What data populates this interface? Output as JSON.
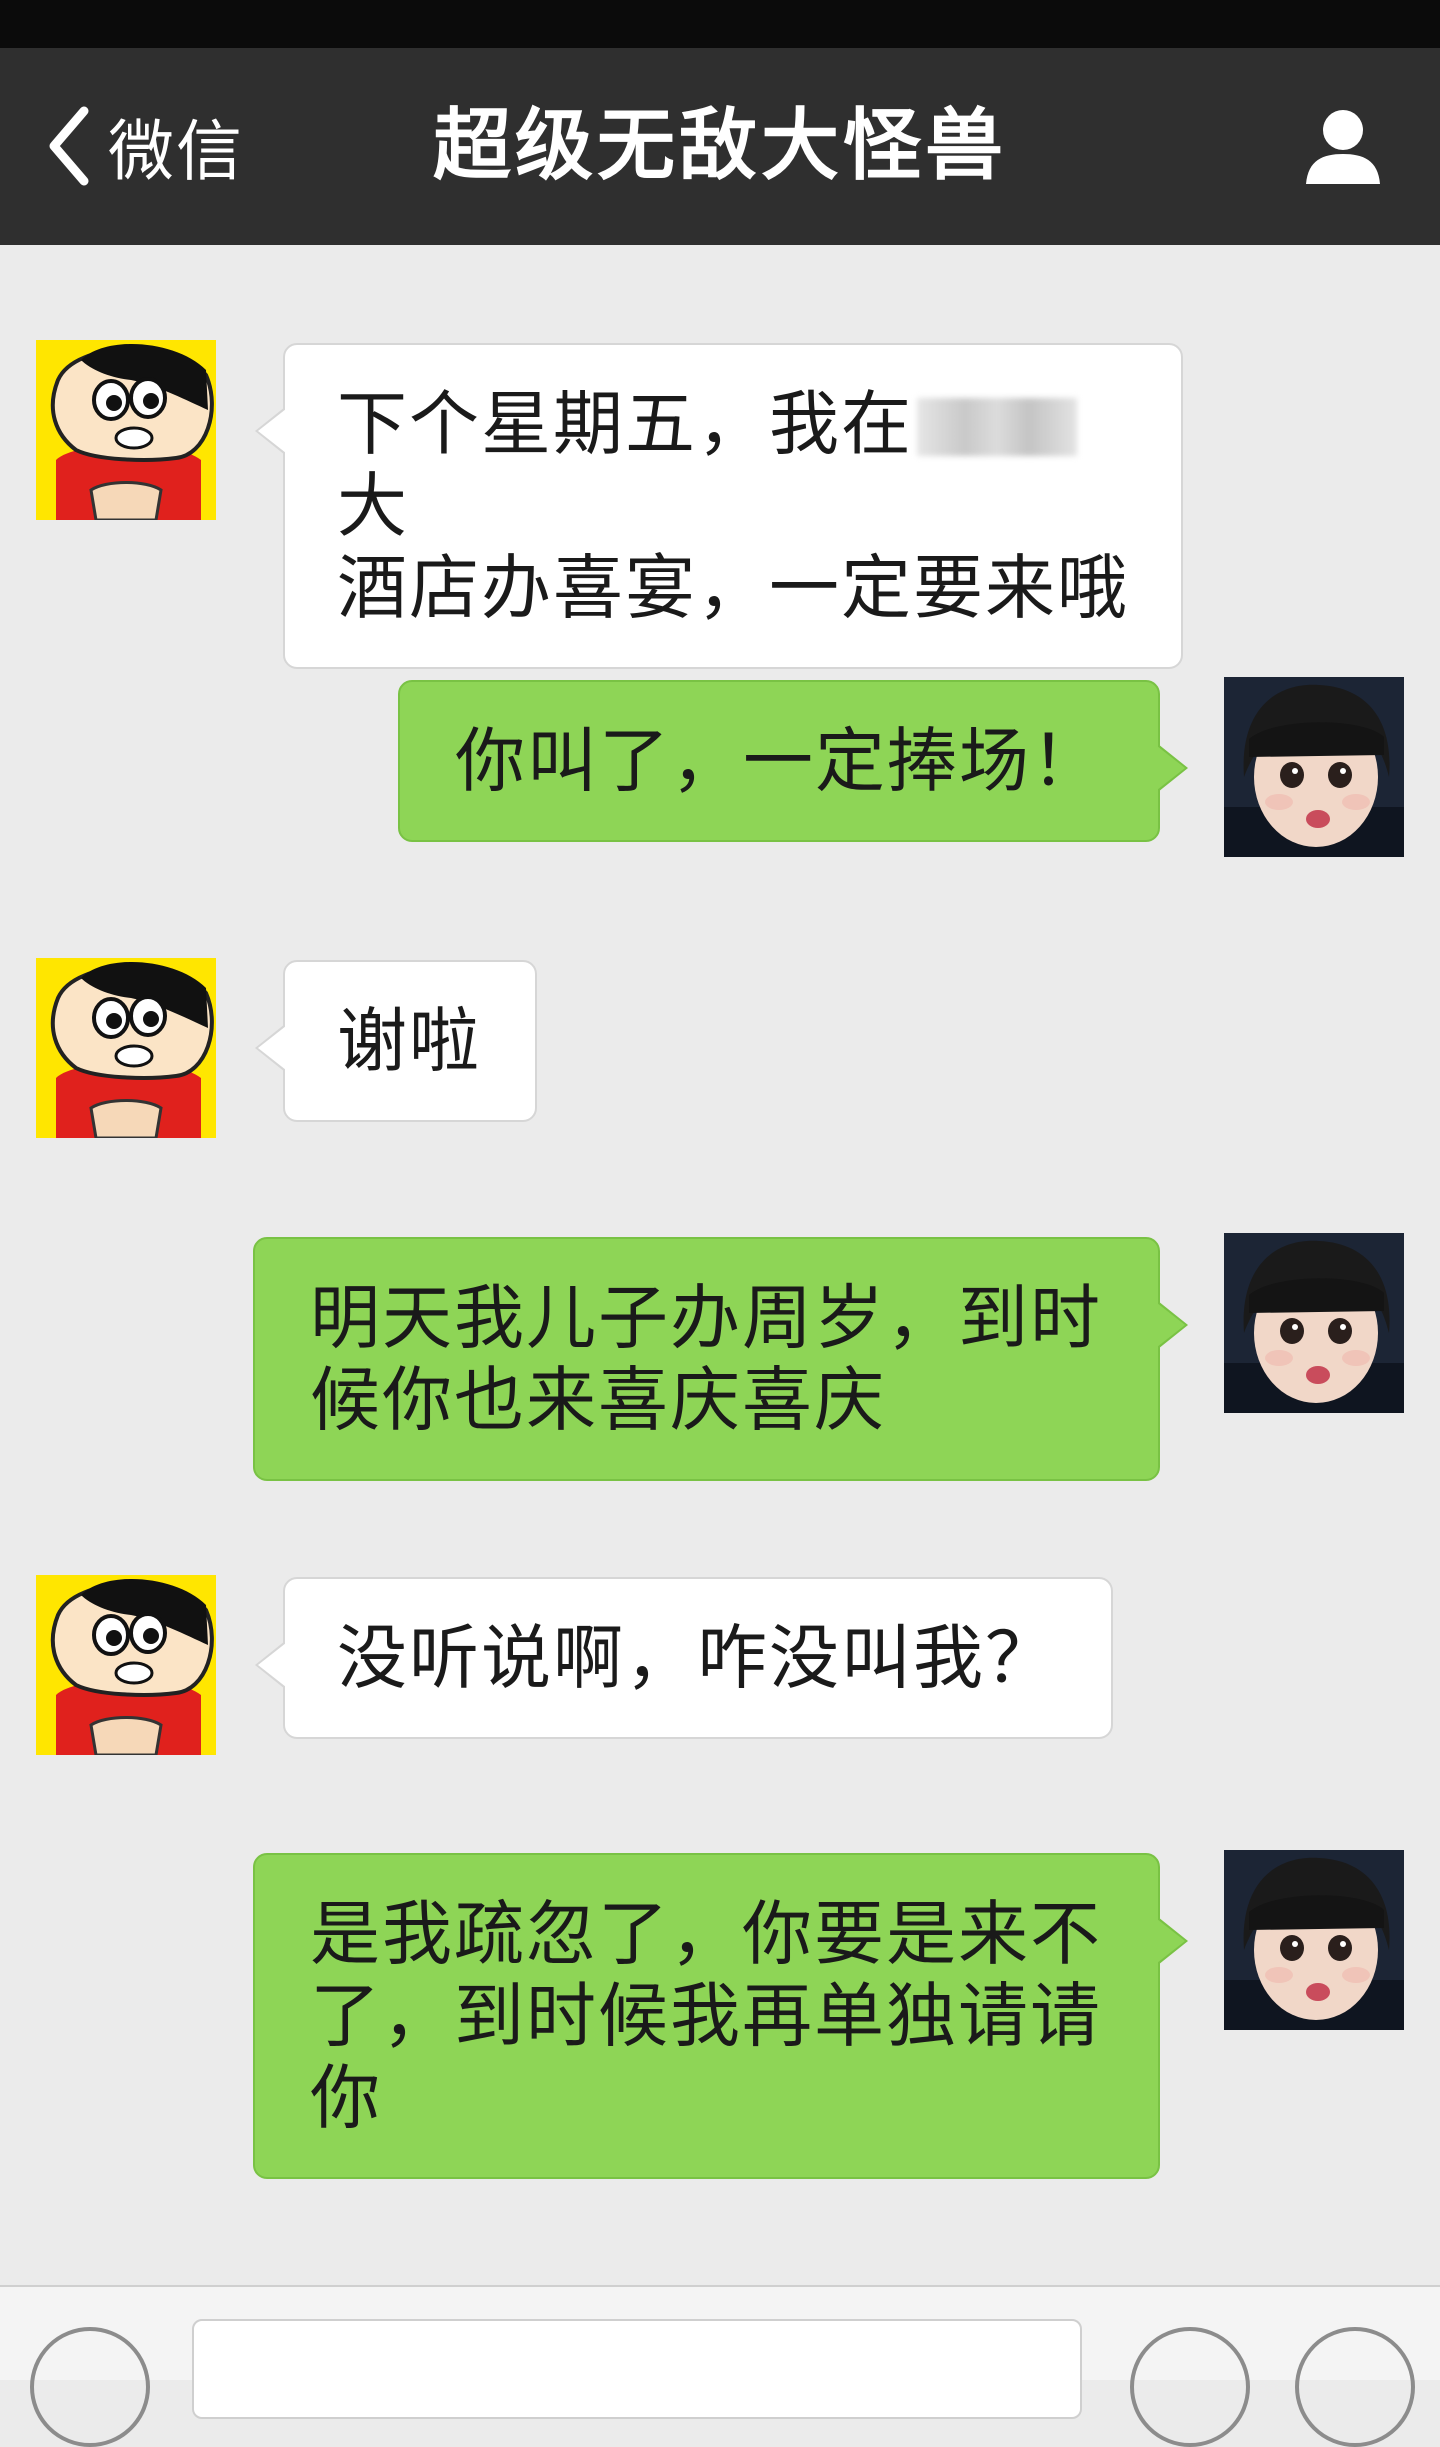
{
  "nav": {
    "back_label": "微信",
    "title": "超级无敌大怪兽"
  },
  "messages": [
    {
      "side": "in",
      "text_before": "下个星期五，我在",
      "text_after": "大\n酒店办喜宴，一定要来哦"
    },
    {
      "side": "out",
      "text": "你叫了，一定捧场！"
    },
    {
      "side": "in",
      "text": "谢啦"
    },
    {
      "side": "out",
      "text": "明天我儿子办周岁，到时\n候你也来喜庆喜庆"
    },
    {
      "side": "in",
      "text": "没听说啊，咋没叫我？"
    },
    {
      "side": "out",
      "text": "是我疏忽了，你要是来不\n了，到时候我再单独请请\n你"
    }
  ],
  "colors": {
    "nav_bg": "#2f2f2f",
    "chat_bg": "#ebebeb",
    "outgoing_bubble": "#8ed556",
    "incoming_bubble": "#ffffff"
  },
  "icons": {
    "back": "chevron-left-icon",
    "profile": "person-icon",
    "incoming_avatar": "cartoon-boy-avatar",
    "outgoing_avatar": "girl-photo-avatar",
    "voice": "voice-icon",
    "emoji": "emoji-icon",
    "more": "plus-icon"
  }
}
